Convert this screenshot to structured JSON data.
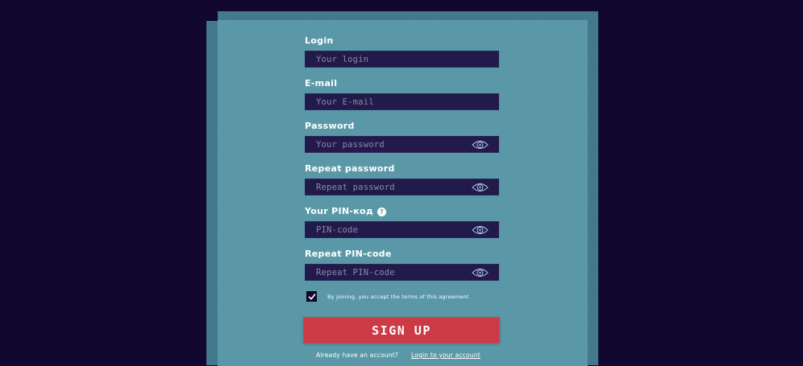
{
  "form": {
    "fields": [
      {
        "label": "Login",
        "placeholder": "Your login",
        "value": "",
        "has_eye": false
      },
      {
        "label": "E-mail",
        "placeholder": "Your E-mail",
        "value": "",
        "has_eye": false
      },
      {
        "label": "Password",
        "placeholder": "Your password",
        "value": "",
        "has_eye": true
      },
      {
        "label": "Repeat password",
        "placeholder": "Repeat password",
        "value": "",
        "has_eye": true
      },
      {
        "label": "Your PIN-код",
        "placeholder": "PIN-code",
        "value": "",
        "has_eye": true,
        "help_icon": "?"
      },
      {
        "label": "Repeat PIN-code",
        "placeholder": "Repeat PIN-code",
        "value": "",
        "has_eye": true
      }
    ],
    "agreement": {
      "checked": true,
      "text": "By joining, you accept the terms of this agreement"
    },
    "submit_label": "SIGN UP",
    "footer": {
      "text": "Already have an account?",
      "link_text": "Login to your account"
    }
  },
  "icons": {
    "eye": "eye-icon",
    "help": "question-circle-icon",
    "check": "checkmark-icon"
  },
  "colors": {
    "page_background": "#12072e",
    "panel": "#5a98a8",
    "panel_frame": "#3f7589",
    "input_background": "#221a4a",
    "button": "#cc3a45",
    "text": "#ffffff"
  }
}
